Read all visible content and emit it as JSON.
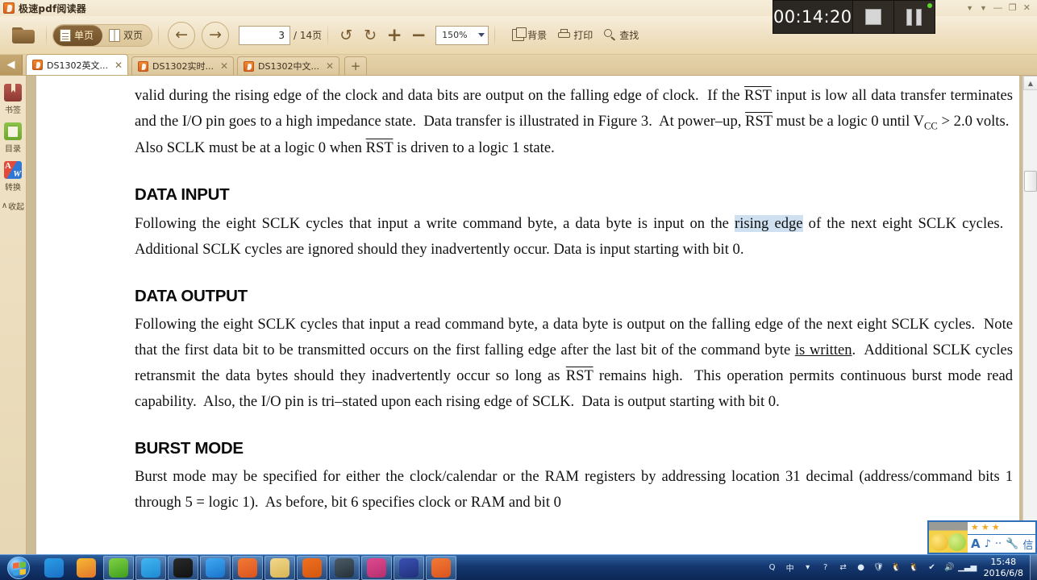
{
  "window": {
    "title": "极速pdf阅读器",
    "app_icon": "pdf-app-icon",
    "controls": {
      "skin": "▼",
      "theme": "▼",
      "minimize": "—",
      "maximize": "❐",
      "close": "✕"
    }
  },
  "toolbar": {
    "open_label": "open-folder",
    "view_modes": [
      {
        "label": "单页",
        "icon": "single-page-icon",
        "active": true
      },
      {
        "label": "双页",
        "icon": "dual-page-icon",
        "active": false
      }
    ],
    "prev_page": "←",
    "next_page": "→",
    "page_current": "3",
    "page_total": "/ 14页",
    "rotate_left": "↺",
    "rotate_right": "↻",
    "zoom_in": "+",
    "zoom_out": "−",
    "zoom_level": "150%",
    "actions": [
      {
        "label": "背景",
        "icon": "background-icon"
      },
      {
        "label": "打印",
        "icon": "printer-icon"
      },
      {
        "label": "查找",
        "icon": "search-icon"
      }
    ]
  },
  "tabs": {
    "scroll_left": "◀",
    "items": [
      {
        "label": "DS1302英文...",
        "active": true
      },
      {
        "label": "DS1302实时...",
        "active": false
      },
      {
        "label": "DS1302中文...",
        "active": false
      }
    ],
    "close_glyph": "✕",
    "add_glyph": "+"
  },
  "sidebar": {
    "items": [
      {
        "label": "书签",
        "icon": "bookmark-icon"
      },
      {
        "label": "目录",
        "icon": "table-of-contents-icon"
      },
      {
        "label": "转换",
        "icon": "convert-pdf-to-word-icon"
      }
    ],
    "collapse_label": "收起",
    "collapse_glyph": "∧"
  },
  "document": {
    "paragraphs": [
      {
        "id": "p-intro",
        "segments": [
          {
            "text": "valid during the rising edge of the clock and data bits are output on the falling edge of clock.  If the "
          },
          {
            "text": "RST",
            "style": "overline"
          },
          {
            "text": " input is low all data transfer terminates and the I/O pin goes to a high impedance state.  Data transfer is illustrated in Figure 3.  At power–up, "
          },
          {
            "text": "RST",
            "style": "overline"
          },
          {
            "text": " must be a logic 0 until V"
          },
          {
            "text": "CC",
            "style": "subscript"
          },
          {
            "text": " > 2.0 volts.  Also SCLK must be at a logic 0 when "
          },
          {
            "text": "RST",
            "style": "overline"
          },
          {
            "text": " is driven to a logic 1 state."
          }
        ]
      }
    ],
    "sections": [
      {
        "heading": "DATA INPUT",
        "segments": [
          {
            "text": "Following the eight SCLK cycles that input a write command byte, a data byte is input on the "
          },
          {
            "text": "rising edge",
            "style": "highlight"
          },
          {
            "text": " of the next eight SCLK cycles.   Additional SCLK cycles are ignored should they inadvertently occur.  Data is input starting with bit 0."
          }
        ]
      },
      {
        "heading": "DATA OUTPUT",
        "segments": [
          {
            "text": "Following the eight SCLK cycles that input a read command byte, a data byte is output on the falling edge of the next eight SCLK cycles.  Note that the first data bit to be transmitted occurs on the first falling edge after the last bit of the command byte "
          },
          {
            "text": "is written",
            "style": "underline"
          },
          {
            "text": ".  Additional SCLK cycles retransmit the data bytes should they inadvertently occur so long as "
          },
          {
            "text": "RST",
            "style": "overline"
          },
          {
            "text": " remains high.  This operation permits continuous burst mode read capability.  Also, the I/O pin is tri–stated upon each rising edge of SCLK.  Data is output starting with bit 0."
          }
        ]
      },
      {
        "heading": "BURST MODE",
        "segments": [
          {
            "text": "Burst mode may be specified for either the clock/calendar or the RAM registers by addressing location 31 decimal (address/command bits 1 through 5 = logic 1).  As before, bit 6 specifies clock or RAM and bit 0"
          }
        ]
      }
    ]
  },
  "scrollbar": {
    "up_glyph": "▲",
    "down_glyph": "▼"
  },
  "recorder": {
    "elapsed": "00:14:20",
    "stop_label": "stop-button",
    "pause_label": "pause-button"
  },
  "ime": {
    "stars": "★ ★ ★",
    "tools": [
      "A",
      "♪",
      "··",
      "🔧",
      "信"
    ]
  },
  "taskbar": {
    "start_label": "start-orb",
    "apps": [
      {
        "name": "qq-browser",
        "color1": "#2b9ee6",
        "color2": "#1a6fc4",
        "open": false
      },
      {
        "name": "firefox",
        "color1": "#f7b733",
        "color2": "#e2762a",
        "open": false
      },
      {
        "name": "ie-browser",
        "color1": "#7fd143",
        "color2": "#3f9e1d",
        "open": true
      },
      {
        "name": "360-safe",
        "color1": "#41b6f0",
        "color2": "#1d8ad4",
        "open": true
      },
      {
        "name": "alipay-assistant",
        "color1": "#2a2a2a",
        "color2": "#111111",
        "open": true
      },
      {
        "name": "media-player",
        "color1": "#3fa9f5",
        "color2": "#1a74c9",
        "open": true
      },
      {
        "name": "pdf-reader",
        "color1": "#f47a34",
        "color2": "#d9531f",
        "open": true
      },
      {
        "name": "file-explorer",
        "color1": "#f2d98c",
        "color2": "#d8b455",
        "open": true
      },
      {
        "name": "wps-presentation",
        "color1": "#f07020",
        "color2": "#d2560f",
        "open": true
      },
      {
        "name": "mcu-tool",
        "color1": "#4b5b66",
        "color2": "#25313a",
        "open": true
      },
      {
        "name": "network-tool",
        "color1": "#e0498f",
        "color2": "#b42f6e",
        "open": true
      },
      {
        "name": "keil-uvision4",
        "color1": "#3a51b5",
        "color2": "#22307a",
        "open": true
      },
      {
        "name": "pdf-reader-2",
        "color1": "#f47a34",
        "color2": "#d9531f",
        "open": true
      }
    ],
    "tray": [
      {
        "name": "qq-tray-icon",
        "glyph": "Q"
      },
      {
        "name": "ime-chinese-icon",
        "glyph": "中"
      },
      {
        "name": "ime-caret-icon",
        "glyph": "▾"
      },
      {
        "name": "help-icon",
        "glyph": "?"
      },
      {
        "name": "sync-icon",
        "glyph": "⇄"
      },
      {
        "name": "hidden-icons-icon",
        "glyph": "●"
      },
      {
        "name": "shield-icon",
        "glyph": "🛡"
      },
      {
        "name": "qq-penguin-icon",
        "glyph": "🐧"
      },
      {
        "name": "qq-penguin-2-icon",
        "glyph": "🐧"
      },
      {
        "name": "safe-remove-icon",
        "glyph": "✔"
      },
      {
        "name": "volume-icon",
        "glyph": "🔊"
      },
      {
        "name": "network-icon",
        "glyph": "▁▃▅"
      }
    ],
    "clock_time": "15:48",
    "clock_date": "2016/6/8"
  }
}
